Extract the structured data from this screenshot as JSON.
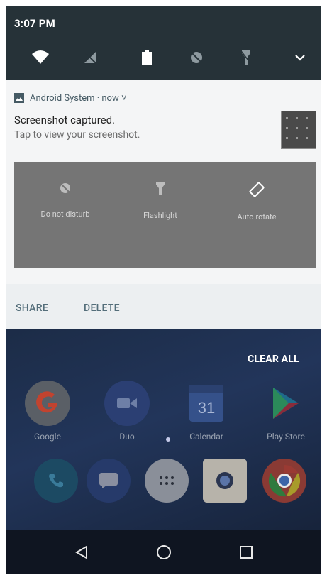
{
  "status": {
    "time": "3:07 PM"
  },
  "notification": {
    "app_label": "Android System · now ˅",
    "title": "Screenshot captured.",
    "text": "Tap to view your screenshot.",
    "preview_tiles": [
      {
        "label": "Do not disturb",
        "icon": "dnd-icon"
      },
      {
        "label": "Flashlight",
        "icon": "flashlight-icon"
      },
      {
        "label": "Auto-rotate",
        "icon": "rotate-icon"
      }
    ],
    "actions": {
      "share": "SHARE",
      "delete": "DELETE"
    }
  },
  "home": {
    "clear_all": "CLEAR ALL",
    "apps": [
      {
        "label": "Google",
        "icon": "google-icon"
      },
      {
        "label": "Duo",
        "icon": "duo-icon"
      },
      {
        "label": "Calendar",
        "icon": "calendar-icon",
        "day": "31"
      },
      {
        "label": "Play Store",
        "icon": "playstore-icon"
      }
    ],
    "dock": [
      "phone-icon",
      "messages-icon",
      "app-drawer-icon",
      "camera-icon",
      "chrome-icon"
    ]
  },
  "colors": {
    "shade": "#263238",
    "card": "#f4f5f6",
    "accent": "#546e7a"
  }
}
